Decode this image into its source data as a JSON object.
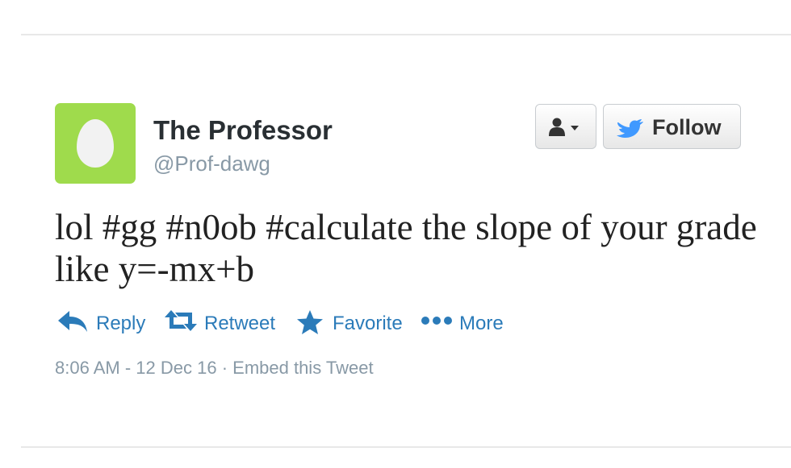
{
  "user": {
    "display_name": "The Professor",
    "handle": "@Prof-dawg"
  },
  "header_actions": {
    "follow_label": "Follow"
  },
  "tweet": {
    "text": "lol #gg #n0ob #calculate the slope of your grade like y=-mx+b"
  },
  "actions": {
    "reply": "Reply",
    "retweet": "Retweet",
    "favorite": "Favorite",
    "more": "More"
  },
  "meta": {
    "timestamp": "8:06 AM - 12 Dec 16",
    "separator": "·",
    "embed": "Embed this Tweet"
  },
  "icons": {
    "avatar": "default-egg-avatar",
    "user_menu": "person-icon",
    "follow": "bird-icon",
    "reply": "reply-arrow-icon",
    "retweet": "retweet-icon",
    "favorite": "star-icon",
    "more": "dots-icon"
  },
  "colors": {
    "accent": "#2b7bb9",
    "avatar_bg": "#9fdb4c",
    "muted": "#8899a6"
  }
}
